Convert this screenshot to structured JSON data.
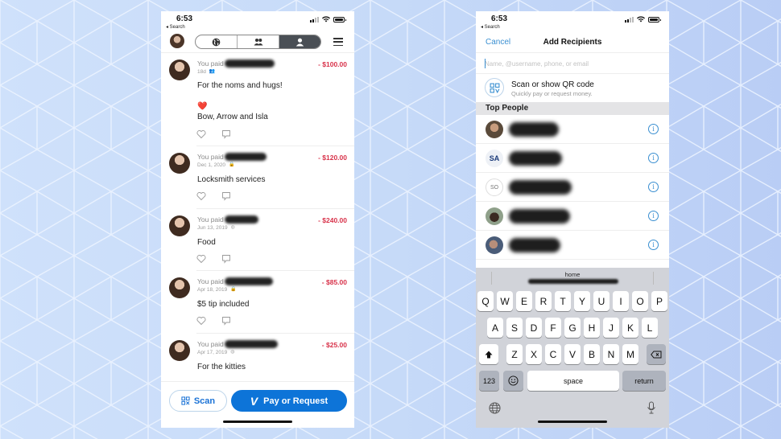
{
  "colors": {
    "venmo_blue": "#0d74d8",
    "link_blue": "#3a8fd1",
    "debit_red": "#d8324a",
    "bg_left": "#cfe1fb",
    "bg_right": "#b9cdf5"
  },
  "left_phone": {
    "status": {
      "time": "6:53",
      "back_label": "◂ Search",
      "location_icon": "location-arrow-icon"
    },
    "header": {
      "tabs": [
        {
          "name": "globe-icon",
          "label": "Public",
          "active": false
        },
        {
          "name": "friends-icon",
          "label": "Friends",
          "active": false
        },
        {
          "name": "person-icon",
          "label": "Mine",
          "active": true
        }
      ],
      "menu_icon": "hamburger-icon"
    },
    "feed": [
      {
        "title": "You paid",
        "amount": "- $100.00",
        "date": "18d",
        "privacy": "friends-icon",
        "note_lines": [
          "For the noms and hugs!",
          "",
          "❤️",
          "Bow, Arrow and Isla"
        ]
      },
      {
        "title": "You paid",
        "amount": "- $120.00",
        "date": "Dec 1, 2020",
        "privacy": "lock-icon",
        "note_lines": [
          "Locksmith services"
        ]
      },
      {
        "title": "You paid",
        "amount": "- $240.00",
        "date": "Jun 13, 2019",
        "privacy": "globe-icon",
        "note_lines": [
          "Food"
        ]
      },
      {
        "title": "You paid",
        "amount": "- $85.00",
        "date": "Apr 18, 2019",
        "privacy": "lock-icon",
        "note_lines": [
          "$5 tip included"
        ]
      },
      {
        "title": "You paid",
        "amount": "- $25.00",
        "date": "Apr 17, 2019",
        "privacy": "globe-icon",
        "note_lines": [
          "For the kitties"
        ]
      }
    ],
    "bottom": {
      "scan_label": "Scan",
      "pay_label": "Pay or Request",
      "pay_logo": "V"
    }
  },
  "right_phone": {
    "status": {
      "time": "6:53",
      "back_label": "◂ Search"
    },
    "header": {
      "cancel_label": "Cancel",
      "title": "Add Recipients"
    },
    "search": {
      "placeholder": "Name, @username, phone, or email",
      "value": ""
    },
    "qr": {
      "title": "Scan or show QR code",
      "subtitle": "Quickly pay or request money."
    },
    "section_title": "Top People",
    "people": [
      {
        "avatar": "photo",
        "initials": ""
      },
      {
        "avatar": "logo",
        "initials": "SA"
      },
      {
        "avatar": "initials",
        "initials": "SO"
      },
      {
        "avatar": "photo",
        "initials": ""
      },
      {
        "avatar": "photo",
        "initials": ""
      }
    ],
    "keyboard": {
      "suggestion": "home",
      "row1": [
        "Q",
        "W",
        "E",
        "R",
        "T",
        "Y",
        "U",
        "I",
        "O",
        "P"
      ],
      "row2": [
        "A",
        "S",
        "D",
        "F",
        "G",
        "H",
        "J",
        "K",
        "L"
      ],
      "row3": [
        "Z",
        "X",
        "C",
        "V",
        "B",
        "N",
        "M"
      ],
      "numbers_label": "123",
      "space_label": "space",
      "return_label": "return"
    }
  }
}
